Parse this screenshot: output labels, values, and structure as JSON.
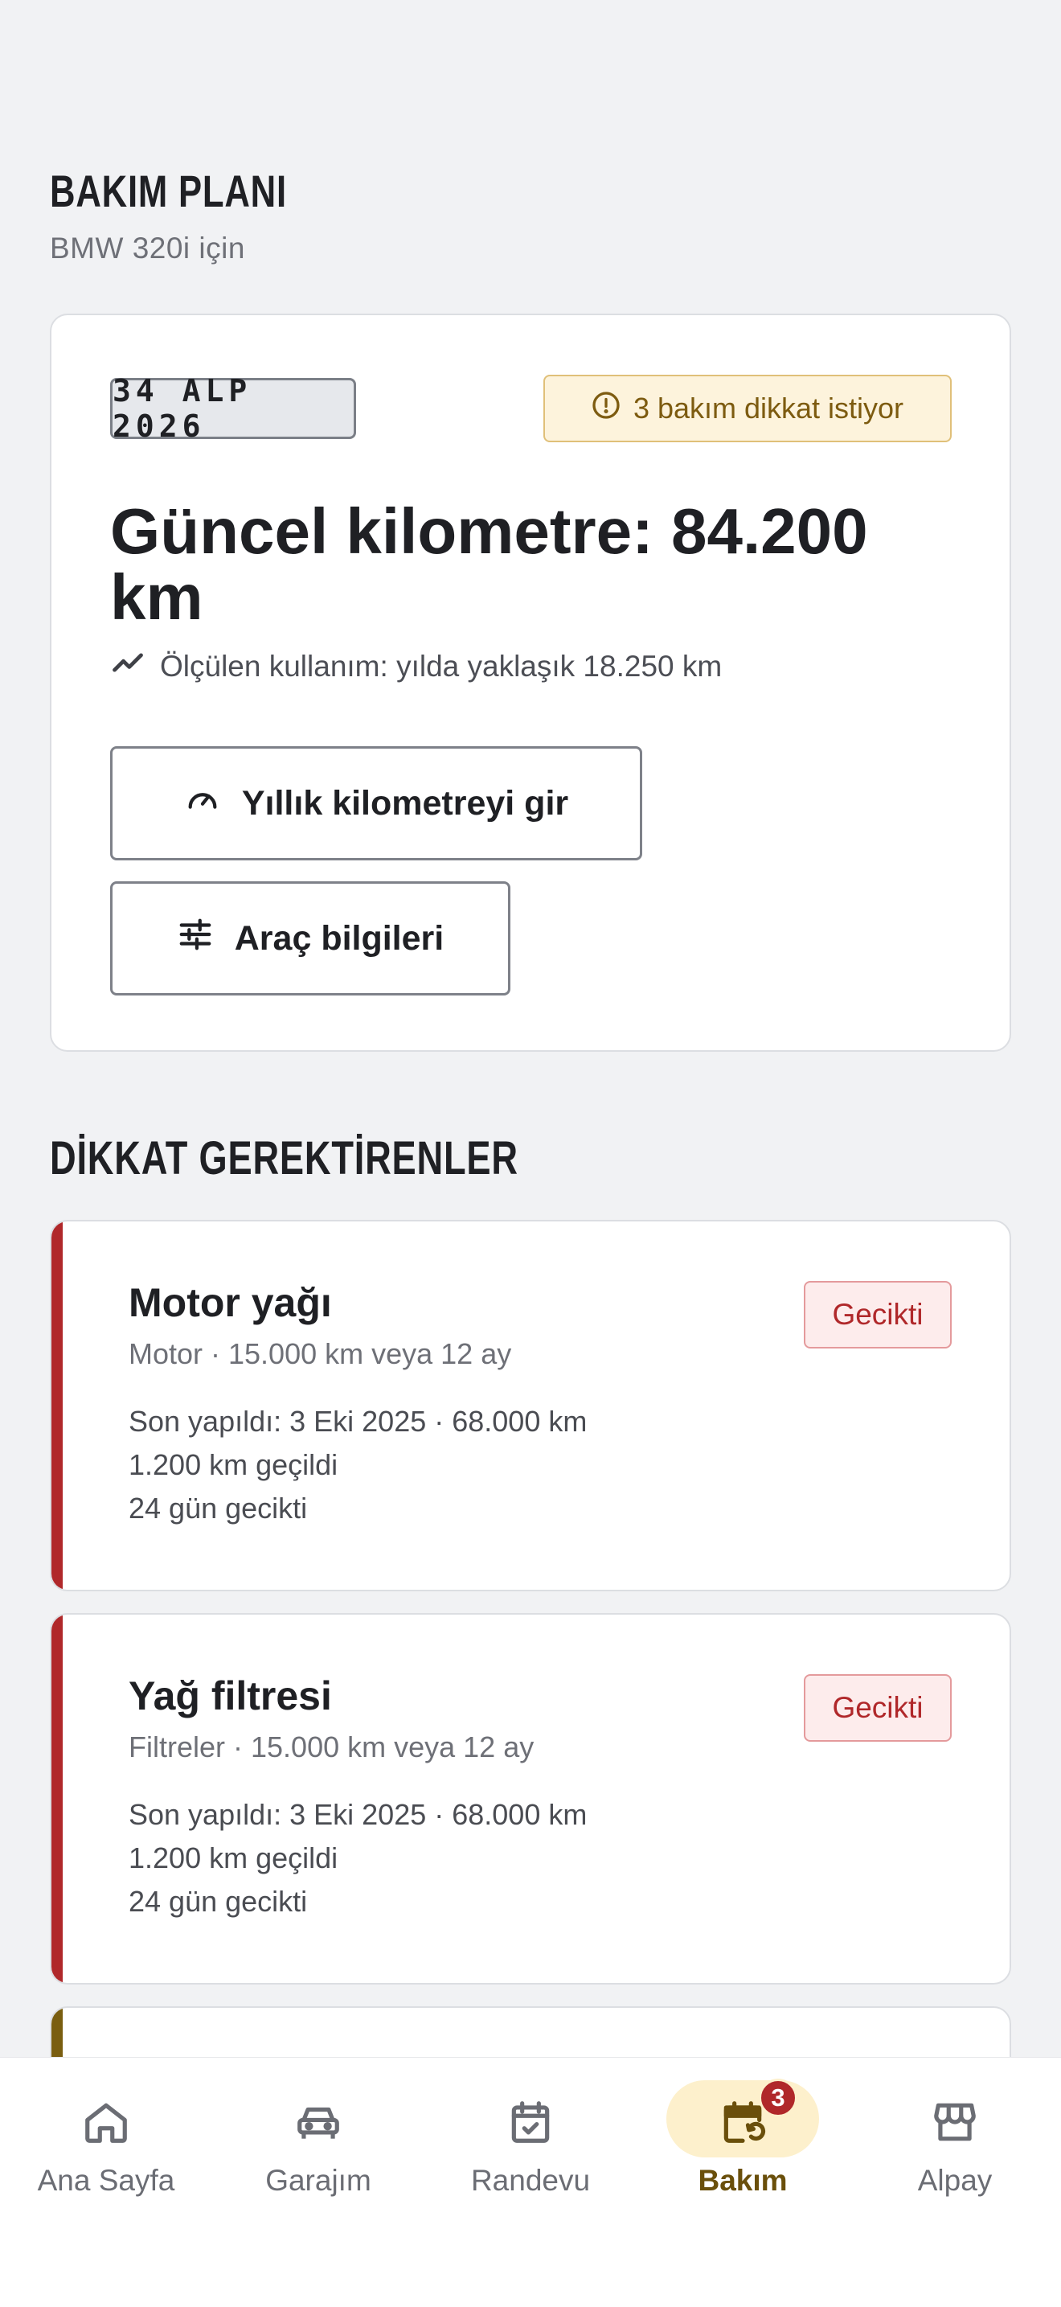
{
  "header": {
    "title": "BAKIM PLANI",
    "subtitle": "BMW 320i için"
  },
  "vehicle": {
    "plate": "34 ALP 2026",
    "alert": "3 bakım dikkat istiyor",
    "odometer_title": "Güncel kilometre: 84.200 km",
    "usage": "Ölçülen kullanım: yılda yaklaşık 18.250 km",
    "annual_km_button": "Yıllık kilometreyi gir",
    "vehicle_info_button": "Araç bilgileri"
  },
  "attention": {
    "title": "DİKKAT GEREKTİRENLER",
    "items": [
      {
        "title": "Motor yağı",
        "meta": "Motor · 15.000 km veya 12 ay",
        "last_done": "Son yapıldı: 3 Eki 2025 · 68.000 km",
        "km_status": "1.200 km geçildi",
        "day_status": "24 gün gecikti",
        "status": "Gecikti"
      },
      {
        "title": "Yağ filtresi",
        "meta": "Filtreler · 15.000 km veya 12 ay",
        "last_done": "Son yapıldı: 3 Eki 2025 · 68.000 km",
        "km_status": "1.200 km geçildi",
        "day_status": "24 gün gecikti",
        "status": "Gecikti"
      }
    ]
  },
  "nav": {
    "items": [
      {
        "label": "Ana Sayfa",
        "icon": "home-icon"
      },
      {
        "label": "Garajım",
        "icon": "car-icon"
      },
      {
        "label": "Randevu",
        "icon": "calendar-check-icon"
      },
      {
        "label": "Bakım",
        "icon": "calendar-refresh-icon",
        "badge": "3",
        "active": true
      },
      {
        "label": "Alpay",
        "icon": "store-icon"
      }
    ]
  },
  "colors": {
    "background": "#f1f2f4",
    "overdue_red": "#b0282a",
    "warning_amber": "#7d5b10",
    "active_nav_bg": "#fdf0cc"
  }
}
